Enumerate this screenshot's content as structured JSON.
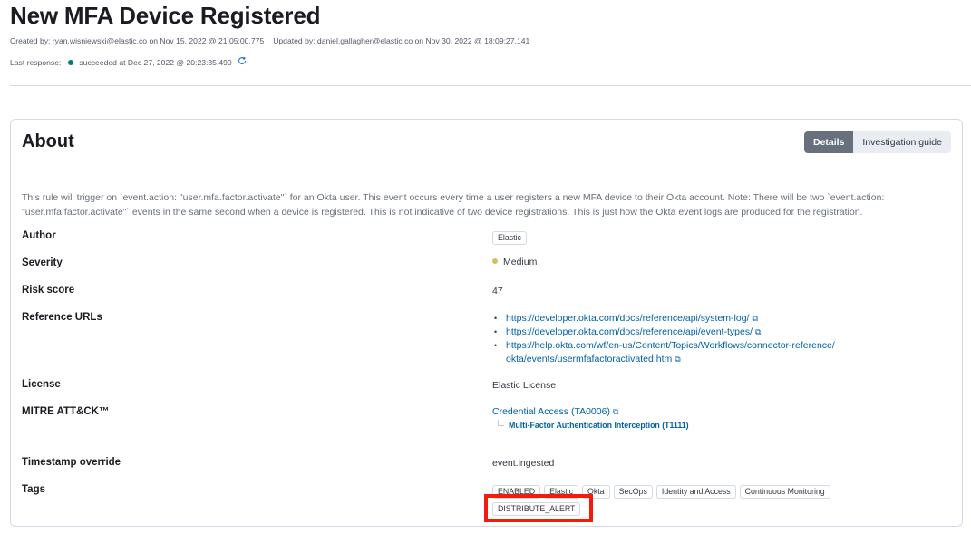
{
  "header": {
    "title": "New MFA Device Registered",
    "created_by": "Created by: ryan.wisniewski@elastic.co on Nov 15, 2022 @ 21:05:00.775",
    "updated_by": "Updated by: daniel.gallagher@elastic.co on Nov 30, 2022 @ 18:09:27.141",
    "last_response_label": "Last response:",
    "last_response_status": "succeeded at Dec 27, 2022 @ 20:23:35.490",
    "status_color": "#017d73",
    "refresh_icon": "refresh-icon"
  },
  "about": {
    "title": "About",
    "tabs": [
      {
        "label": "Details",
        "active": true
      },
      {
        "label": "Investigation guide",
        "active": false
      }
    ],
    "description": "This rule will trigger on `event.action: \"user.mfa.factor.activate\"` for an Okta user. This event occurs every time a user registers a new MFA device to their Okta account. Note: There will be two `event.action: \"user.mfa.factor.activate\"` events in the same second when a device is registered. This is not indicative of two device registrations. This is just how the Okta event logs are produced for the registration.",
    "fields": {
      "author": {
        "label": "Author",
        "value": "Elastic"
      },
      "severity": {
        "label": "Severity",
        "value": "Medium",
        "color": "#d6bf57"
      },
      "risk_score": {
        "label": "Risk score",
        "value": "47"
      },
      "reference_urls": {
        "label": "Reference URLs",
        "items": [
          "https://developer.okta.com/docs/reference/api/system-log/",
          "https://developer.okta.com/docs/reference/api/event-types/",
          "https://help.okta.com/wf/en-us/Content/Topics/Workflows/connector-reference/okta/events/usermfafactoractivated.htm"
        ]
      },
      "license": {
        "label": "License",
        "value": "Elastic License"
      },
      "mitre": {
        "label": "MITRE ATT&CK™",
        "tactic": "Credential Access (TA0006)",
        "technique": "Multi-Factor Authentication Interception (T1111)"
      },
      "timestamp_override": {
        "label": "Timestamp override",
        "value": "event.ingested"
      },
      "tags": {
        "label": "Tags",
        "items": [
          "ENABLED",
          "Elastic",
          "Okta",
          "SecOps",
          "Identity and Access",
          "Continuous Monitoring",
          "DISTRIBUTE_ALERT"
        ],
        "highlighted": "DISTRIBUTE_ALERT",
        "highlight_color": "#f61a0b"
      }
    }
  }
}
